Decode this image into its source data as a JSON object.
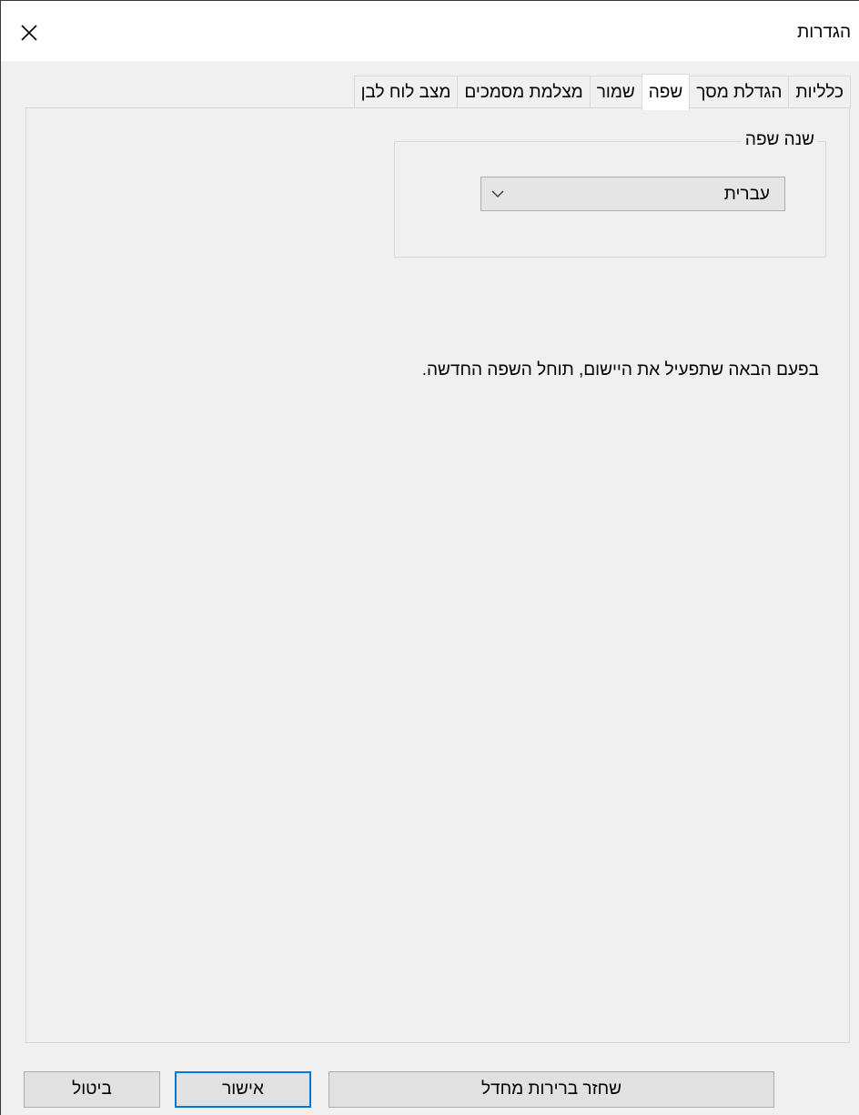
{
  "window": {
    "title": "הגדרות"
  },
  "close_icon": "close-icon",
  "tabs": [
    {
      "label": "כלליות",
      "active": false
    },
    {
      "label": "הגדלת מסך",
      "active": false
    },
    {
      "label": "שפה",
      "active": true
    },
    {
      "label": "שמור",
      "active": false
    },
    {
      "label": "מצלמת מסמכים",
      "active": false
    },
    {
      "label": "מצב לוח לבן",
      "active": false
    }
  ],
  "language_group": {
    "legend": "שנה שפה",
    "selected": "עברית"
  },
  "notice": "בפעם הבאה שתפעיל את היישום, תוחל השפה החדשה.",
  "buttons": {
    "reset": "שחזר ברירות מחדל",
    "ok": "אישור",
    "cancel": "ביטול"
  },
  "colors": {
    "background": "#f0f0f0",
    "titlebar": "#ffffff",
    "accent": "#0078d7"
  }
}
